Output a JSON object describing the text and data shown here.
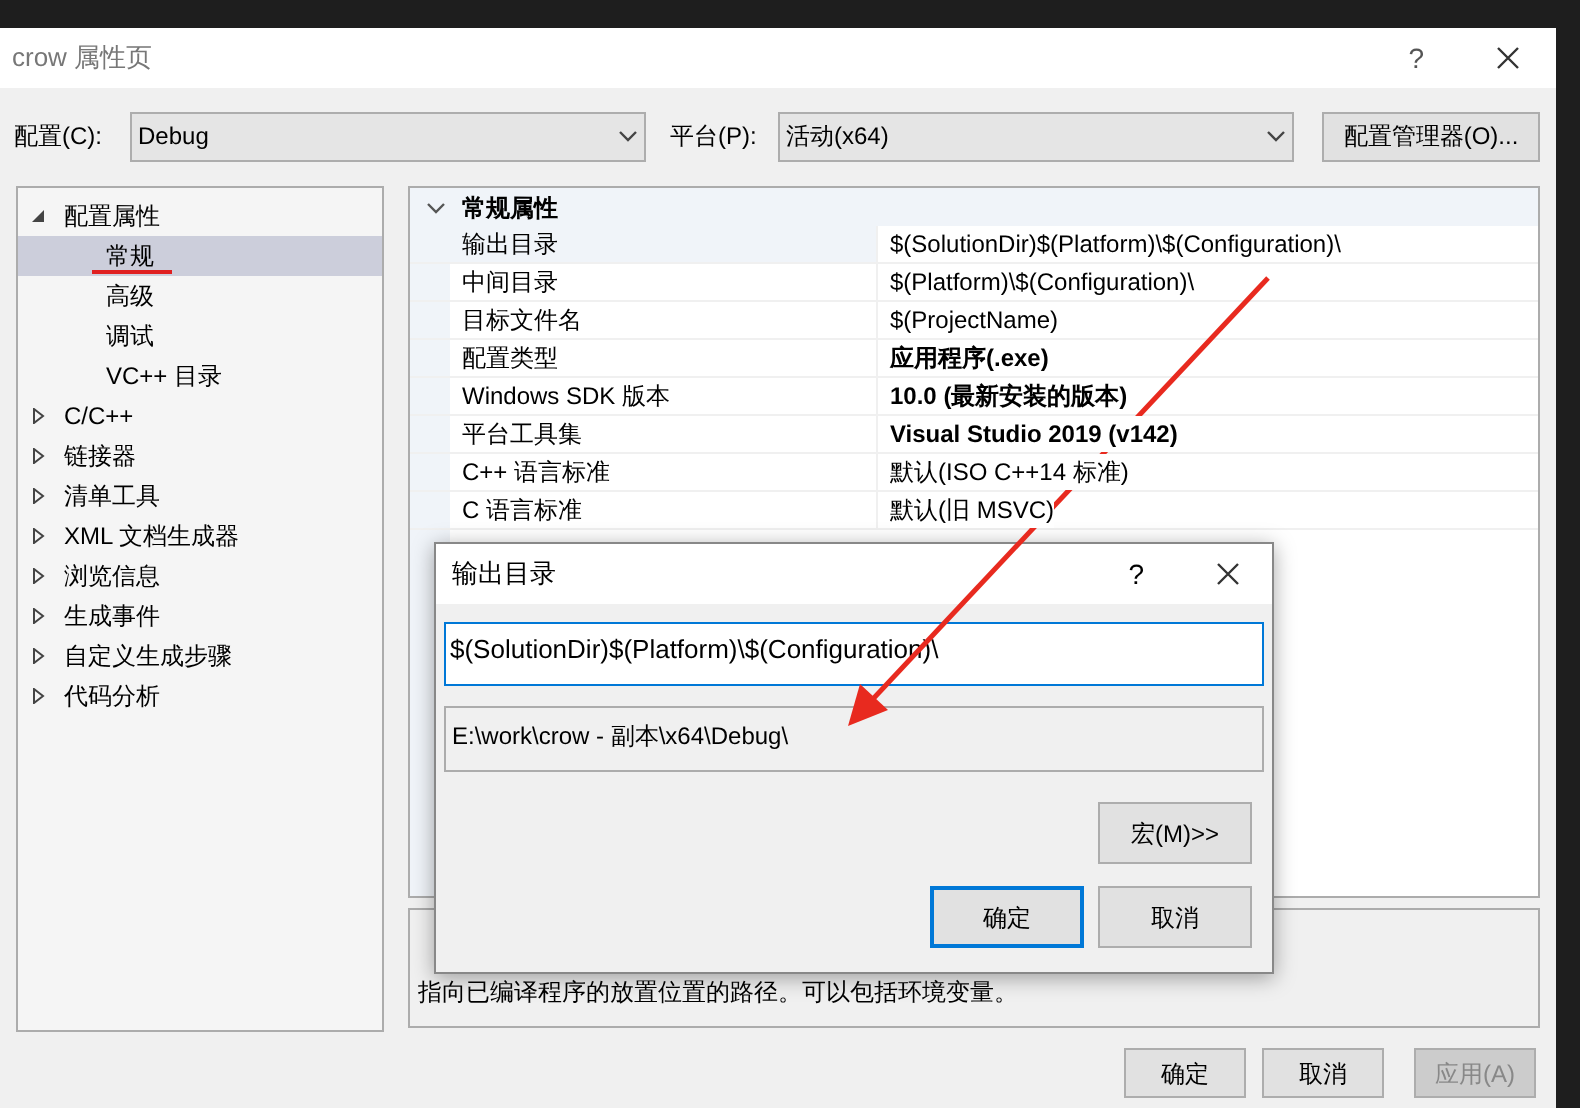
{
  "window": {
    "title": "crow 属性页",
    "help": "?"
  },
  "config": {
    "label": "配置(C):",
    "value": "Debug",
    "platform_label": "平台(P):",
    "platform_value": "活动(x64)",
    "manager_button": "配置管理器(O)..."
  },
  "tree": [
    {
      "label": "配置属性",
      "expanded": true,
      "children": [
        {
          "label": "常规",
          "selected": true
        },
        {
          "label": "高级",
          "selected": false
        },
        {
          "label": "调试",
          "selected": false
        },
        {
          "label": "VC++ 目录",
          "selected": false
        }
      ]
    },
    {
      "label": "C/C++",
      "expanded": false
    },
    {
      "label": "链接器",
      "expanded": false
    },
    {
      "label": "清单工具",
      "expanded": false
    },
    {
      "label": "XML 文档生成器",
      "expanded": false
    },
    {
      "label": "浏览信息",
      "expanded": false
    },
    {
      "label": "生成事件",
      "expanded": false
    },
    {
      "label": "自定义生成步骤",
      "expanded": false
    },
    {
      "label": "代码分析",
      "expanded": false
    }
  ],
  "grid": {
    "category": "常规属性",
    "expanded": true,
    "rows": [
      {
        "name": "输出目录",
        "value": "$(SolutionDir)$(Platform)\\$(Configuration)\\",
        "bold": false,
        "selected": true
      },
      {
        "name": "中间目录",
        "value": "$(Platform)\\$(Configuration)\\",
        "bold": false,
        "selected": false
      },
      {
        "name": "目标文件名",
        "value": "$(ProjectName)",
        "bold": false,
        "selected": false
      },
      {
        "name": "配置类型",
        "value": "应用程序(.exe)",
        "bold": true,
        "selected": false
      },
      {
        "name": "Windows SDK 版本",
        "value": "10.0 (最新安装的版本)",
        "bold": true,
        "selected": false
      },
      {
        "name": "平台工具集",
        "value": "Visual Studio 2019 (v142)",
        "bold": true,
        "selected": false
      },
      {
        "name": "C++ 语言标准",
        "value": "默认(ISO C++14 标准)",
        "bold": false,
        "selected": false
      },
      {
        "name": "C 语言标准",
        "value": "默认(旧 MSVC)",
        "bold": false,
        "selected": false
      }
    ]
  },
  "description": "指向已编译程序的放置位置的路径。可以包括环境变量。",
  "buttons": [
    {
      "label": "确定",
      "disabled": false
    },
    {
      "label": "取消",
      "disabled": false
    },
    {
      "label": "应用(A)",
      "disabled": true
    }
  ],
  "dialog": {
    "title": "输出目录",
    "help": "?",
    "value": "$(SolutionDir)$(Platform)\\$(Configuration)\\",
    "evaluated": "E:\\work\\crow - 副本\\x64\\Debug\\",
    "macro_button": "宏(M)>>",
    "buttons": [
      {
        "label": "确定",
        "default": true
      },
      {
        "label": "取消",
        "default": false
      }
    ]
  }
}
